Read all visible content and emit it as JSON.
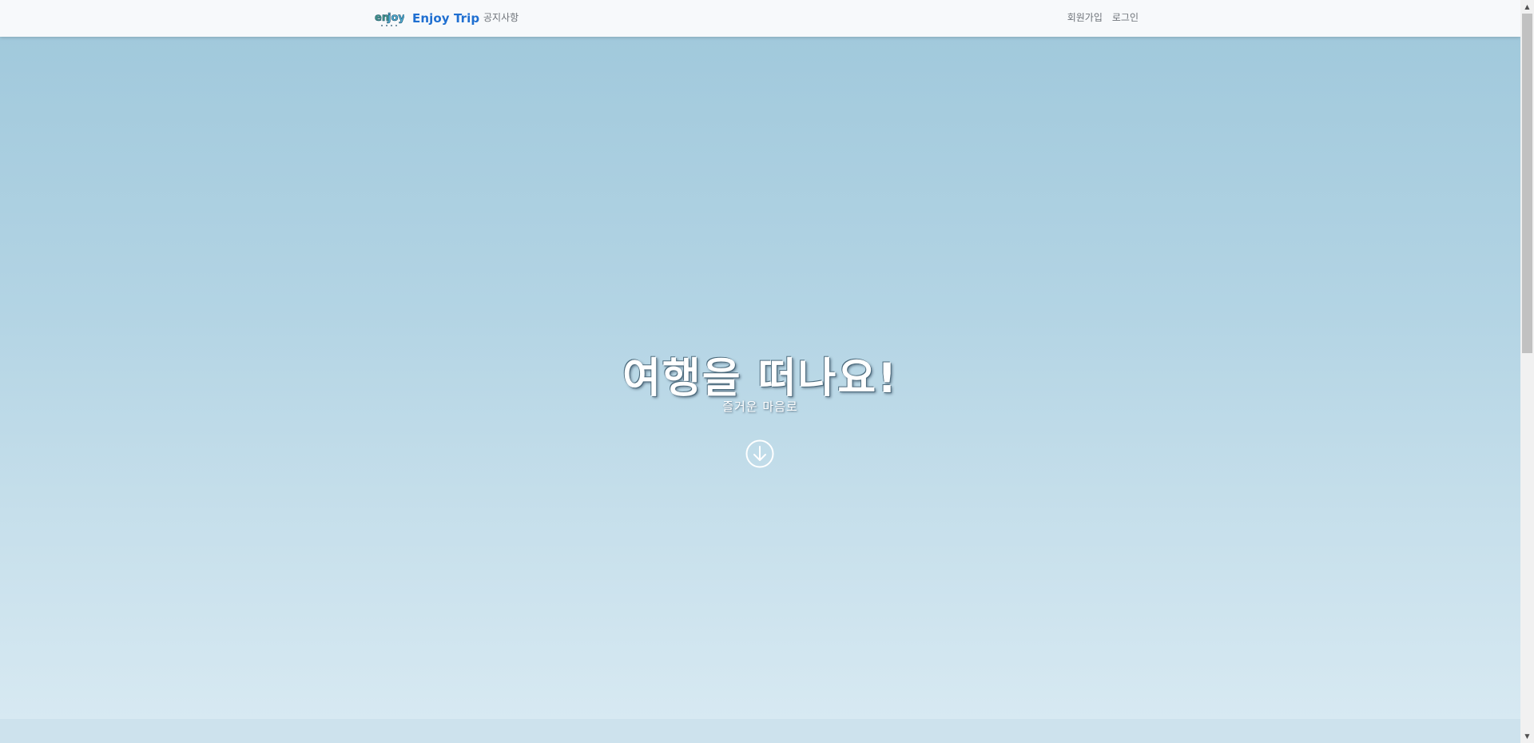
{
  "navbar": {
    "brand_name": "Enjoy Trip",
    "logo_icon": "enjoy-trip-logo",
    "notice_label": "공지사항",
    "signup_label": "회원가입",
    "login_label": "로그인",
    "brand_color": "#1f6fd1"
  },
  "hero": {
    "title": "여행을 떠나요!",
    "subtitle": "즐거운 마음로",
    "scroll_icon": "arrow-down-circle-icon",
    "gradient_top": "#a1c9dc",
    "gradient_bottom": "#d7e9f2"
  },
  "scrollbar": {
    "up_icon": "scroll-up-arrow-icon",
    "down_icon": "scroll-down-arrow-icon"
  }
}
